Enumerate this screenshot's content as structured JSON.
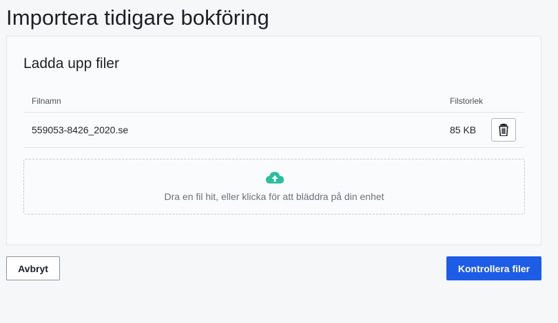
{
  "page": {
    "title": "Importera tidigare bokföring"
  },
  "upload": {
    "title": "Ladda upp filer",
    "columns": {
      "name": "Filnamn",
      "size": "Filstorlek"
    },
    "files": [
      {
        "name": "559053-8426_2020.se",
        "size": "85 KB"
      }
    ],
    "dropzone_text": "Dra en fil hit, eller klicka för att bläddra på din enhet"
  },
  "actions": {
    "cancel_label": "Avbryt",
    "submit_label": "Kontrollera filer"
  },
  "icons": {
    "delete": "trash-icon",
    "upload": "cloud-upload-icon"
  },
  "colors": {
    "primary": "#1d5ce6",
    "upload_icon": "#2bbf9d"
  }
}
